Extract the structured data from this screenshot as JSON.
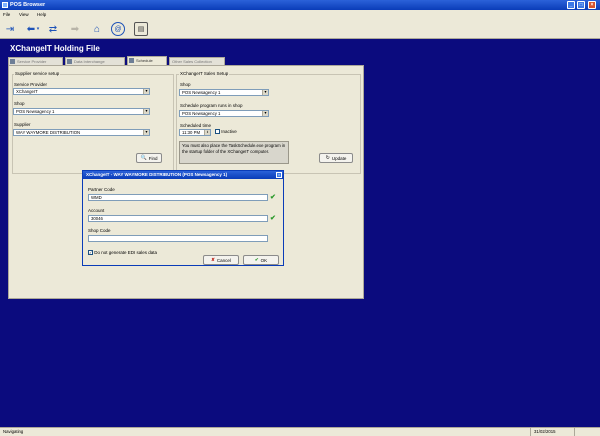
{
  "window": {
    "title": "POS Browser"
  },
  "menu": [
    "File",
    "View",
    "Help"
  ],
  "heading": "XChangeIT Holding File",
  "tabs": [
    "Service Provider",
    "Data Interchange",
    "Schedule",
    "Other Sales Collection"
  ],
  "supplier_setup": {
    "title": "Supplier service setup",
    "service_provider_label": "Service Provider",
    "service_provider_value": "XChangeIT",
    "shop_label": "Shop",
    "shop_value": "POS Newsagency 1",
    "supplier_label": "Supplier",
    "supplier_value": "WAY WAYMORE DISTRIBUTION",
    "find_button": "Find"
  },
  "sales_setup": {
    "title": "XChangeIT Sales Setup",
    "shop_label": "Shop",
    "shop_value": "POS Newsagency 1",
    "schedule_shop_label": "Schedule program runs in shop",
    "schedule_shop_value": "POS Newsagency 1",
    "time_label": "Scheduled time",
    "time_value": "11:30 PM",
    "inactive_label": "Inactive",
    "note": "You must also place the TaskSchedule.exe program in the startup folder of the XChangeIT computer.",
    "update_button": "Update"
  },
  "dialog": {
    "title": "XChangeIT - WAY WAYMORE DISTRIBUTION (POS Newsagency 1)",
    "partner_code_label": "Partner Code",
    "partner_code_value": "WMD",
    "account_label": "Account",
    "account_value": "30046",
    "shop_code_label": "Shop Code",
    "shop_code_value": "",
    "no_edi_label": "Do not generate EDI sales data",
    "cancel_button": "Cancel",
    "ok_button": "OK"
  },
  "status": {
    "text": "Navigating",
    "date": "31/02/2015"
  },
  "colors": {
    "desktop": "#0b0b7e",
    "titlebar": "#0a3cb8",
    "panel": "#ece9d8",
    "tick": "#2c9a2c"
  }
}
